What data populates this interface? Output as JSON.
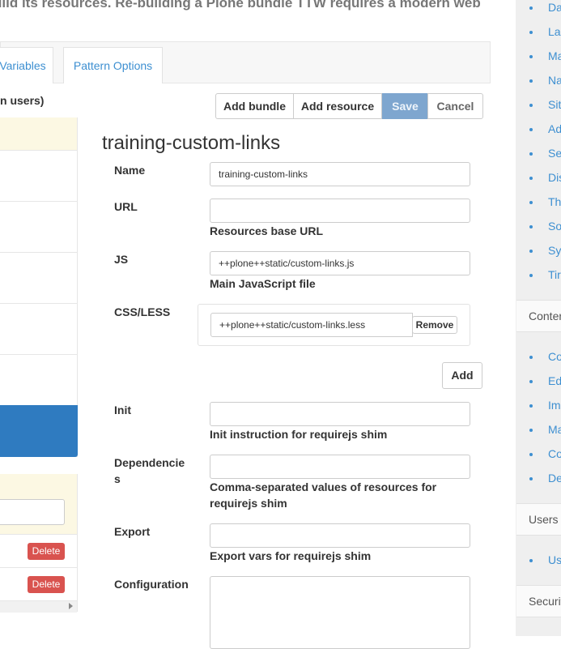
{
  "intro_text": "uild its resources. Re-building a Plone bundle TTW requires a modern web",
  "tabs": [
    {
      "label": "Variables"
    },
    {
      "label": "Pattern Options"
    }
  ],
  "left_panel": {
    "heading": "n users)",
    "delete_label": "Delete"
  },
  "toolbar": {
    "add_bundle": "Add bundle",
    "add_resource": "Add resource",
    "save": "Save",
    "cancel": "Cancel"
  },
  "resource": {
    "title": "training-custom-links",
    "fields": {
      "name": {
        "label": "Name",
        "value": "training-custom-links"
      },
      "url": {
        "label": "URL",
        "value": "",
        "help": "Resources base URL"
      },
      "js": {
        "label": "JS",
        "value": "++plone++static/custom-links.js",
        "help": "Main JavaScript file"
      },
      "css": {
        "label": "CSS/LESS",
        "value": "++plone++static/custom-links.less",
        "remove": "Remove",
        "add": "Add"
      },
      "init": {
        "label": "Init",
        "value": "",
        "help": "Init instruction for requirejs shim"
      },
      "deps": {
        "label1": "Dependencie",
        "label2": "s",
        "value": "",
        "help": "Comma-separated values of resources for requirejs shim"
      },
      "export": {
        "label": "Export",
        "value": "",
        "help": "Export vars for requirejs shim"
      },
      "config": {
        "label": "Configuration",
        "value": ""
      }
    }
  },
  "sidebar": {
    "site_items": [
      "Da",
      "La",
      "Ma",
      "Na",
      "Sit",
      "Ad",
      "Se",
      "Dis",
      "Th",
      "So",
      "Sy",
      "Tir"
    ],
    "content_heading": "Conter",
    "content_items": [
      "Co",
      "Ed",
      "Im",
      "Ma",
      "Co",
      "De"
    ],
    "users_heading": "Users",
    "users_items": [
      "Us"
    ],
    "security_heading": "Securit"
  },
  "colors": {
    "link": "#3d8fd1",
    "primary": "#2f7bc0",
    "save_disabled": "#7ea6cf",
    "danger": "#d9534f",
    "warning_bg": "#fcf8e3"
  }
}
